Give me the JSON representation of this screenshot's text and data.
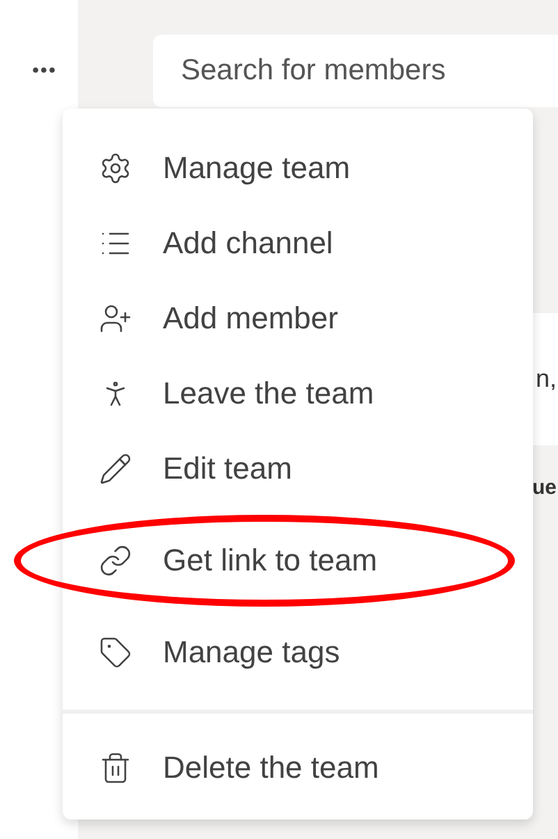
{
  "more_button": {
    "label": "•••"
  },
  "search": {
    "placeholder": "Search for members"
  },
  "background_fragments": [
    {
      "text": "n,",
      "bold": false
    },
    {
      "text": "ue",
      "bold": true
    }
  ],
  "menu": {
    "groups": [
      [
        {
          "label": "Manage team",
          "highlighted": false
        },
        {
          "label": "Add channel",
          "highlighted": false
        },
        {
          "label": "Add member",
          "highlighted": false
        },
        {
          "label": "Leave the team",
          "highlighted": false
        },
        {
          "label": "Edit team",
          "highlighted": false
        },
        {
          "label": "Get link to team",
          "highlighted": true
        },
        {
          "label": "Manage tags",
          "highlighted": false
        }
      ],
      [
        {
          "label": "Delete the team",
          "highlighted": false
        }
      ]
    ]
  }
}
